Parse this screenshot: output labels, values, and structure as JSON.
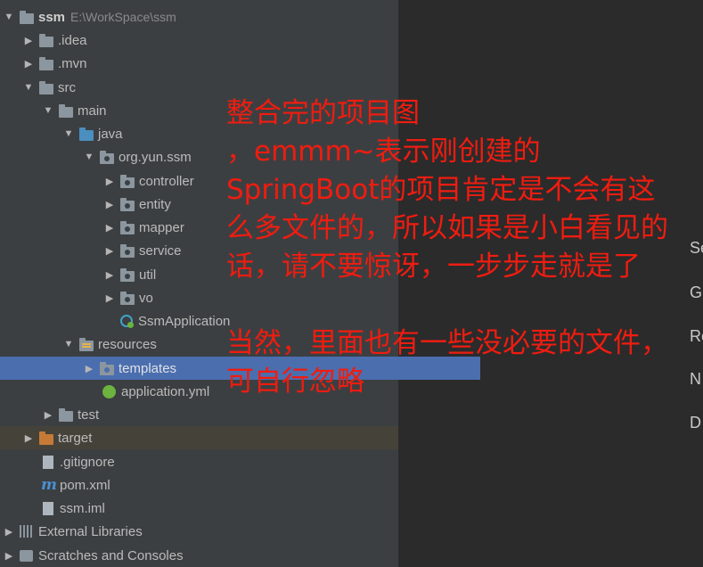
{
  "tree": {
    "project": {
      "name": "ssm",
      "path": "E:\\WorkSpace\\ssm"
    },
    "idea": ".idea",
    "mvn": ".mvn",
    "src": "src",
    "main": "main",
    "java": "java",
    "package": "org.yun.ssm",
    "controller": "controller",
    "entity": "entity",
    "mapper": "mapper",
    "service": "service",
    "util": "util",
    "vo": "vo",
    "ssm_application": "SsmApplication",
    "resources": "resources",
    "templates": "templates",
    "application_yml": "application.yml",
    "test": "test",
    "target": "target",
    "gitignore": ".gitignore",
    "pom": "pom.xml",
    "iml": "ssm.iml",
    "external_libraries": "External Libraries",
    "scratches": "Scratches and Consoles"
  },
  "editor_labels": [
    "Se",
    "G",
    "Re",
    "N",
    "D"
  ],
  "annotations": {
    "line1": "整合完的项目图",
    "line2": "，emmm~表示刚创建的",
    "line3": "SpringBoot的项目肯定是不会有这",
    "line4": "么多文件的，所以如果是小白看见的",
    "line5": "话，请不要惊讶，一步步走就是了",
    "line6": "当然，里面也有一些没必要的文件，",
    "line7": "可自行忽略"
  }
}
